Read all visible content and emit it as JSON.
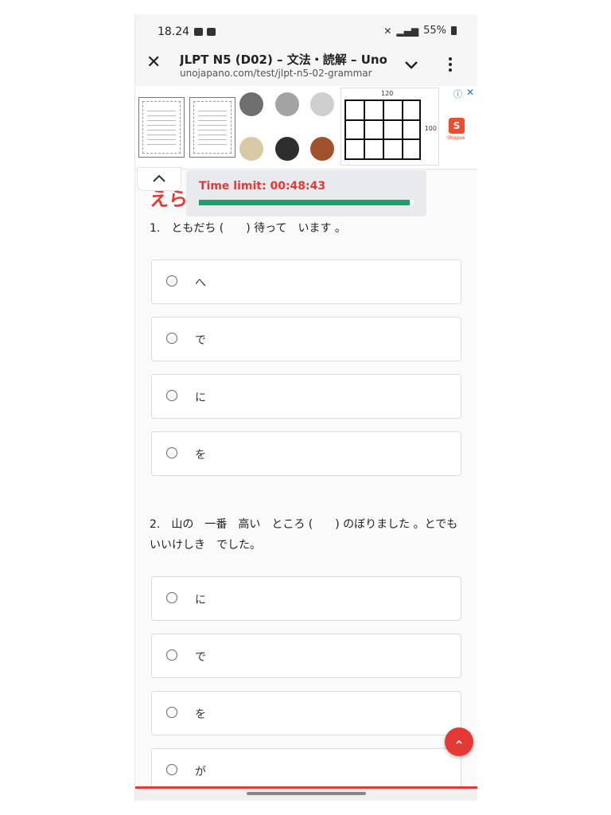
{
  "status_bar": {
    "time": "18.24",
    "battery": "55%"
  },
  "browser": {
    "page_title": "JLPT N5 (D02) – 文法・読解 – Uno",
    "url": "unojapano.com/test/jlpt-n5-02-grammar"
  },
  "ad": {
    "grid_width": "120",
    "grid_height": "100",
    "shop_label": "Shopee"
  },
  "heading": "えら",
  "timer": {
    "text": "Time limit: 00:48:43",
    "progress_percent": 98
  },
  "questions": [
    {
      "text": "1.　ともだち (　　) 待って　います 。",
      "options": [
        "へ",
        "で",
        "に",
        "を"
      ]
    },
    {
      "text": "2.　山の　一番　高い　ところ (　　) のぼりました 。とでも　いいけしき　でした。",
      "options": [
        "に",
        "で",
        "を",
        "が"
      ]
    }
  ],
  "colors": {
    "accent": "#e53935",
    "progress": "#1aa16c"
  }
}
